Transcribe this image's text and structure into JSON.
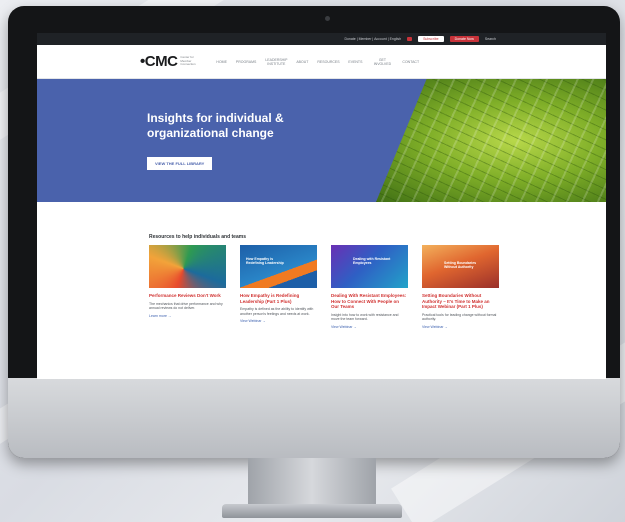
{
  "topbar": {
    "utility_text": "Donate  |  Member  |  Account  |  English",
    "btn_white": "Subscribe",
    "btn_red": "Donate Now",
    "search_text": "Search"
  },
  "nav": {
    "logo": "•CMC",
    "logo_sub": "Center for Member Connection",
    "items": [
      "Home",
      "Programs",
      "Leadership Institute",
      "About",
      "Resources",
      "Events",
      "Get Involved",
      "Contact"
    ]
  },
  "hero": {
    "title": "Insights for individual & organizational change",
    "button": "VIEW THE FULL LIBRARY"
  },
  "resources": {
    "heading": "Resources to help individuals and teams",
    "cards": [
      {
        "title": "Performance Reviews Don't Work",
        "desc": "The mechanics that drive performance and why annual reviews do not deliver.",
        "link": "Learn more →"
      },
      {
        "title": "How Empathy is Redefining Leadership (Part 1 Plus)",
        "desc": "Empathy is defined as the ability to identify with another person's feelings and needs at work.",
        "link": "View Webinar →"
      },
      {
        "title": "Dealing With Resistant Employees: How to Connect With People on Our Teams",
        "desc": "Insight into how to work with resistance and move the team forward.",
        "link": "View Webinar →"
      },
      {
        "title": "Setting Boundaries Without Authority – It's Time to Make an Impact Webinar (Part 1 Plus)",
        "desc": "Practical tools for leading change without formal authority.",
        "link": "View Webinar →"
      }
    ],
    "card_img_labels": [
      "",
      "How Empathy is Redefining Leadership",
      "Dealing with Resistant Employees",
      "Setting Boundaries Without Authority"
    ]
  }
}
